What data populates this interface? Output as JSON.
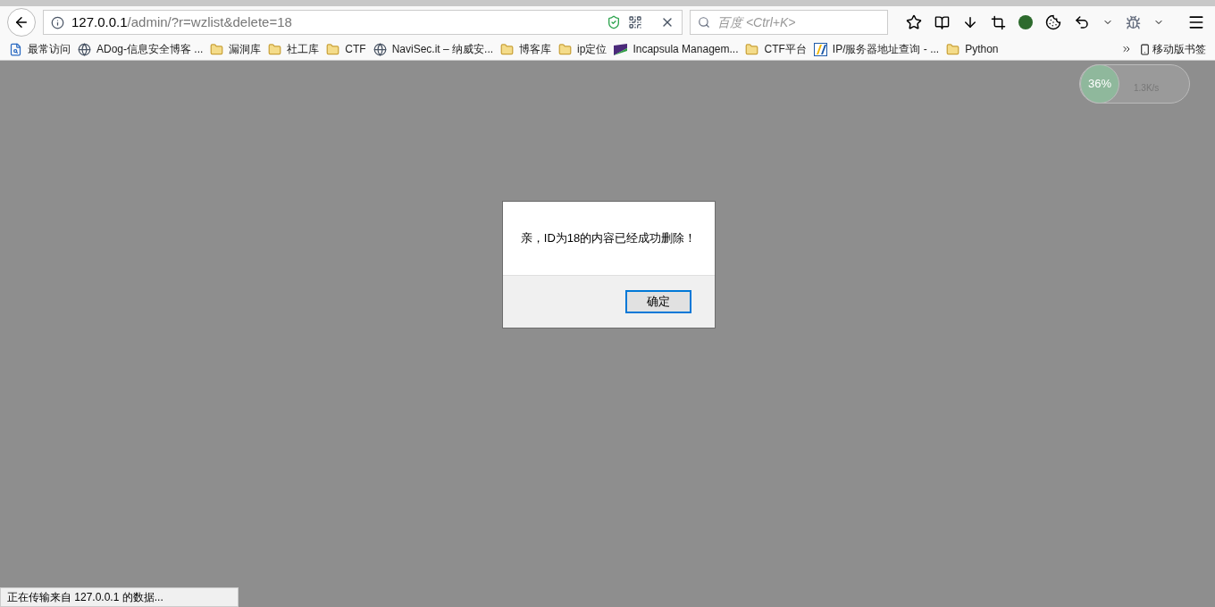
{
  "url": {
    "host": "127.0.0.1",
    "path": "/admin/?r=wzlist&delete=18"
  },
  "search": {
    "placeholder": "百度 <Ctrl+K>"
  },
  "bookmarks": [
    {
      "label": "最常访问",
      "kind": "page"
    },
    {
      "label": "ADog-信息安全博客 ...",
      "kind": "globe"
    },
    {
      "label": "漏洞库",
      "kind": "folder"
    },
    {
      "label": "社工库",
      "kind": "folder"
    },
    {
      "label": "CTF",
      "kind": "folder"
    },
    {
      "label": "NaviSec.it – 纳威安...",
      "kind": "globe"
    },
    {
      "label": "博客库",
      "kind": "folder"
    },
    {
      "label": "ip定位",
      "kind": "folder"
    },
    {
      "label": "Incapsula Managem...",
      "kind": "site"
    },
    {
      "label": "CTF平台",
      "kind": "folder"
    },
    {
      "label": "IP/服务器地址查询 - ...",
      "kind": "tile"
    },
    {
      "label": "Python",
      "kind": "folder"
    }
  ],
  "mobile_bookmarks": "移动版书签",
  "speed_widget": {
    "percent": "36%",
    "rate": "1.3K/s"
  },
  "dialog": {
    "message": "亲，ID为18的内容已经成功删除！",
    "button": "确定"
  },
  "status_bar": "正在传输来自 127.0.0.1 的数据..."
}
